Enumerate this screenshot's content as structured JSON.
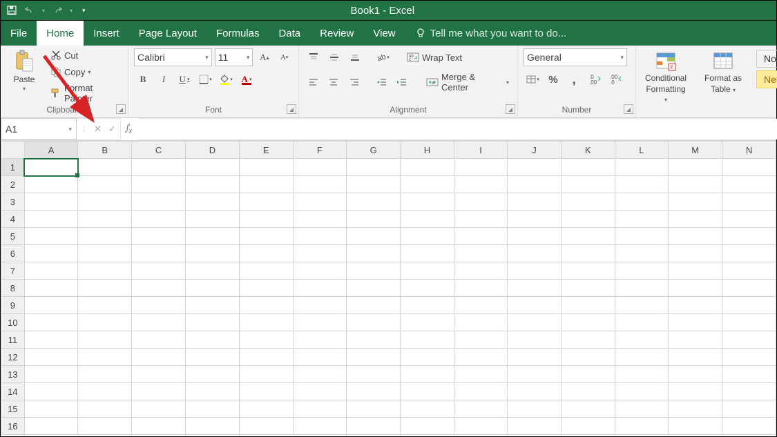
{
  "title": "Book1 - Excel",
  "tabs": [
    "File",
    "Home",
    "Insert",
    "Page Layout",
    "Formulas",
    "Data",
    "Review",
    "View"
  ],
  "active_tab": "Home",
  "tellme": "Tell me what you want to do...",
  "clipboard": {
    "paste": "Paste",
    "cut": "Cut",
    "copy": "Copy",
    "format_painter": "Format Painter",
    "label": "Clipboard"
  },
  "font": {
    "name": "Calibri",
    "size": "11",
    "label": "Font",
    "bold": "B",
    "italic": "I",
    "underline": "U"
  },
  "alignment": {
    "wrap": "Wrap Text",
    "merge": "Merge & Center",
    "label": "Alignment"
  },
  "number": {
    "format": "General",
    "label": "Number"
  },
  "cond_fmt": {
    "l1": "Conditional",
    "l2": "Formatting"
  },
  "fmt_table": {
    "l1": "Format as",
    "l2": "Table"
  },
  "styles": {
    "normal": "Normal",
    "neutral": "Neutral"
  },
  "namebox": "A1",
  "columns": [
    "A",
    "B",
    "C",
    "D",
    "E",
    "F",
    "G",
    "H",
    "I",
    "J",
    "K",
    "L",
    "M",
    "N"
  ],
  "rows": [
    "1",
    "2",
    "3",
    "4",
    "5",
    "6",
    "7",
    "8",
    "9",
    "10",
    "11",
    "12",
    "13",
    "14",
    "15",
    "16"
  ],
  "selected_cell": {
    "row": 0,
    "col": 0
  }
}
